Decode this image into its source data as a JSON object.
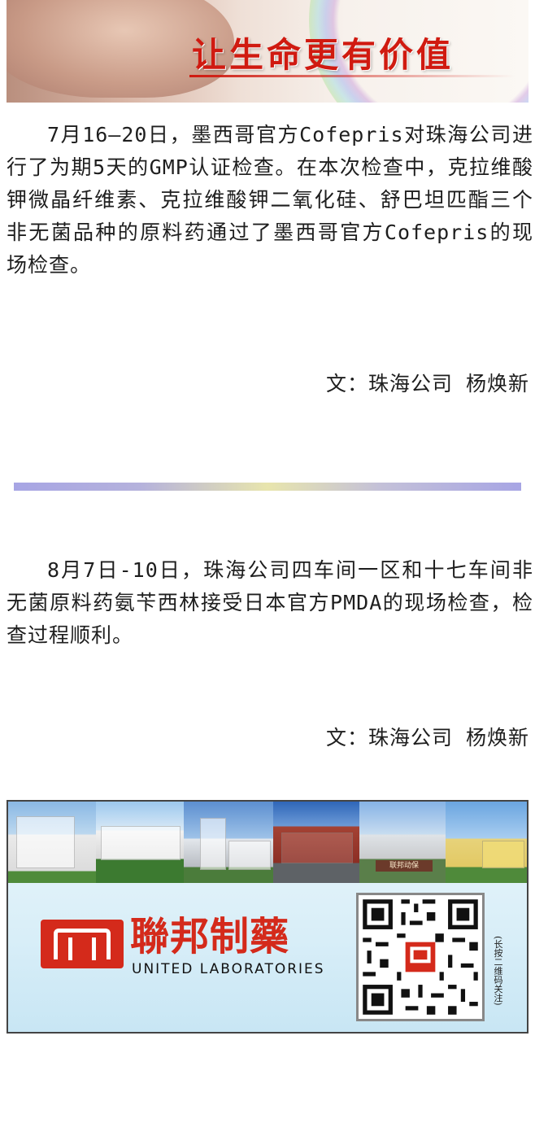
{
  "banner": {
    "slogan": "让生命更有价值"
  },
  "article1": {
    "body": "7月16—20日，墨西哥官方Cofepris对珠海公司进行了为期5天的GMP认证检查。在本次检查中，克拉维酸钾微晶纤维素、克拉维酸钾二氧化硅、舒巴坦匹酯三个非无菌品种的原料药通过了墨西哥官方Cofepris的现场检查。",
    "signature": "文：珠海公司 杨焕新"
  },
  "article2": {
    "body": "8月7日-10日，珠海公司四车间一区和十七车间非无菌原料药氨苄西林接受日本官方PMDA的现场检查，检查过程顺利。",
    "signature": "文：珠海公司 杨焕新"
  },
  "footer": {
    "brand_cn": "聯邦制藥",
    "brand_en": "UNITED LABORATORIES",
    "qr_caption": "(长按二维码关注)",
    "photo_sign": "联邦动保",
    "accent_color": "#d42a1b"
  }
}
